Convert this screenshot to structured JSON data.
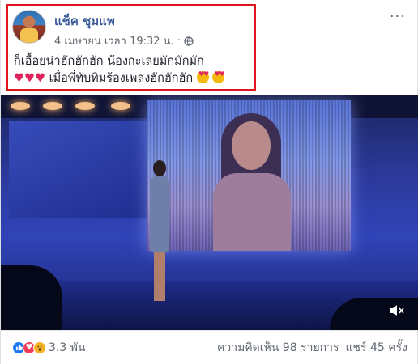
{
  "post": {
    "author": "แช็ค ชุมแพ",
    "timestamp": "4 เมษายน เวลา 19:32 น.",
    "separator": "·",
    "more_label": "···",
    "caption_line1": "ก็เอื้อยน่าฮักฮักฮัก น้องกะเลยมักมักมัก",
    "caption_line2_hearts": "♥♥♥",
    "caption_line2_text": " เมื่อพี่ทับทิมร้องเพลงฮักฮักฮัก "
  },
  "video": {
    "muted": true
  },
  "footer": {
    "reaction_count": "3.3 พัน",
    "comments": "ความคิดเห็น 98 รายการ",
    "shares": "แชร์ 45 ครั้ง"
  },
  "icons": [
    "globe-icon",
    "like-icon",
    "love-icon",
    "wow-icon",
    "mute-icon",
    "heart-eyes-icon"
  ],
  "colors": {
    "author_link": "#385898",
    "highlight_border": "#e0141e",
    "like": "#1877f2",
    "love": "#f33e58",
    "wow": "#f7b125"
  }
}
